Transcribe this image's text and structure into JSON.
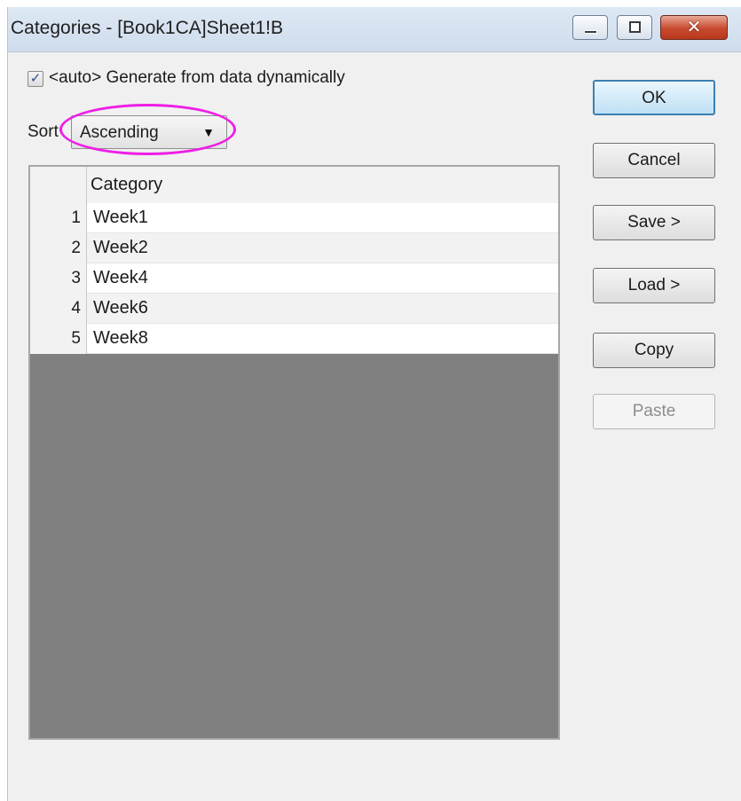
{
  "window": {
    "title": "Categories - [Book1CA]Sheet1!B",
    "close_glyph": "✕"
  },
  "options": {
    "auto_checked": true,
    "check_glyph": "✓",
    "auto_label": "<auto> Generate from data dynamically",
    "sort_label": "Sort",
    "sort_value": "Ascending",
    "sort_arrow": "▼"
  },
  "grid": {
    "column_header": "Category",
    "rows": [
      {
        "num": "1",
        "value": "Week1"
      },
      {
        "num": "2",
        "value": "Week2"
      },
      {
        "num": "3",
        "value": "Week4"
      },
      {
        "num": "4",
        "value": "Week6"
      },
      {
        "num": "5",
        "value": "Week8"
      }
    ]
  },
  "buttons": {
    "ok": "OK",
    "cancel": "Cancel",
    "save": "Save >",
    "load": "Load >",
    "copy": "Copy",
    "paste": "Paste"
  },
  "colors": {
    "highlight": "#ee1ee6",
    "grid_empty": "#808080"
  }
}
